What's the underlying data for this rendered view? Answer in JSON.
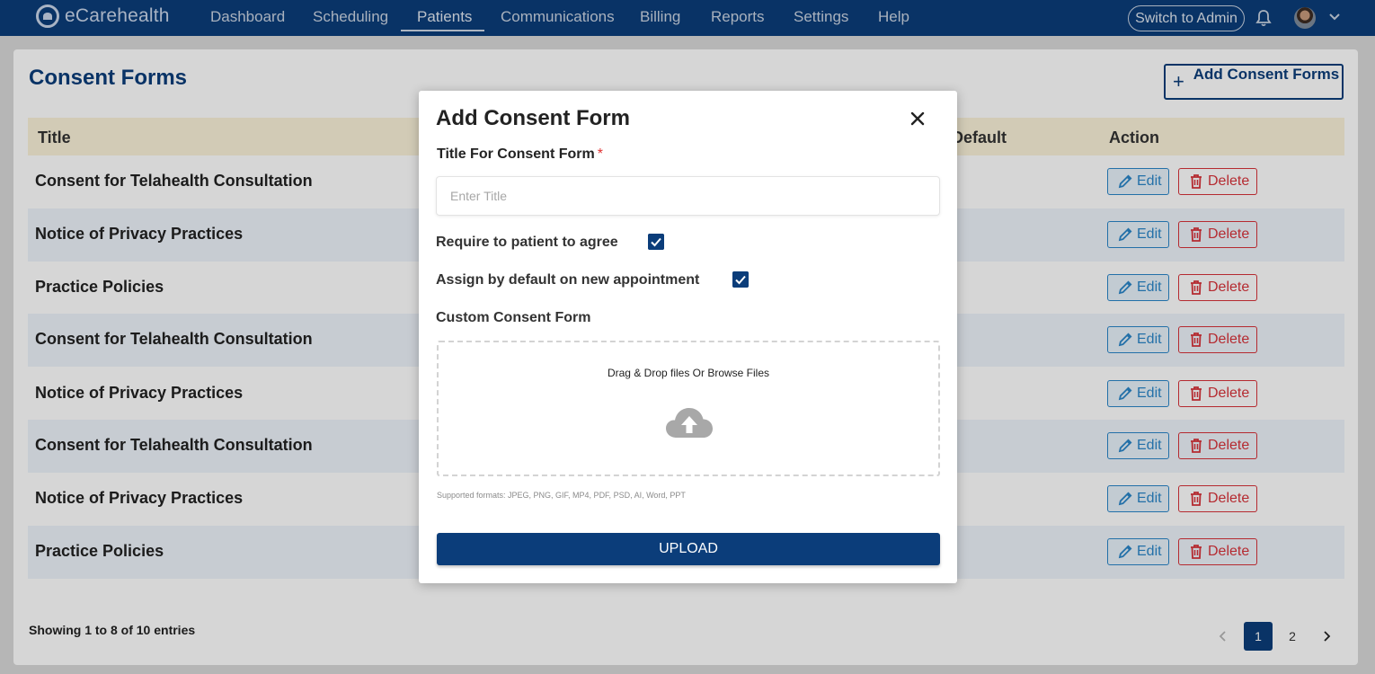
{
  "app": {
    "logo_text": "eCarehealth",
    "nav": [
      "Dashboard",
      "Scheduling",
      "Patients",
      "Communications",
      "Billing",
      "Reports",
      "Settings",
      "Help"
    ],
    "active_nav": "Patients",
    "switch_admin_label": "Switch to Admin",
    "icons": {
      "notifications": "bell-icon",
      "profile": "avatar",
      "profile_menu": "chevron-down-icon"
    }
  },
  "page": {
    "title": "Consent Forms",
    "add_button_label": "Add Consent Forms",
    "columns": {
      "title": "Title",
      "default": "Default",
      "action": "Action"
    },
    "rows": [
      {
        "title": "Consent for Telahealth Consultation"
      },
      {
        "title": "Notice of Privacy Practices"
      },
      {
        "title": "Practice Policies"
      },
      {
        "title": "Consent for Telahealth Consultation"
      },
      {
        "title": "Notice of Privacy Practices"
      },
      {
        "title": "Consent for Telahealth Consultation"
      },
      {
        "title": "Notice of Privacy Practices"
      },
      {
        "title": "Practice Policies"
      }
    ],
    "edit_label": "Edit",
    "delete_label": "Delete",
    "showing_text": "Showing 1 to 8 of 10 entries",
    "pagination": {
      "pages": [
        "1",
        "2"
      ],
      "current": "1"
    }
  },
  "modal": {
    "title": "Add Consent Form",
    "title_field_label": "Title For Consent Form",
    "required_mark": "*",
    "title_placeholder": "Enter Title",
    "title_value": "",
    "require_agree_label": "Require to patient to agree",
    "require_agree_checked": true,
    "assign_default_label": "Assign by default on new appointment",
    "assign_default_checked": true,
    "custom_form_label": "Custom Consent Form",
    "dropzone_text": "Drag & Drop files Or Browse Files",
    "formats_text": "Supported formats: JPEG, PNG, GIF, MP4, PDF, PSD, AI, Word, PPT",
    "upload_label": "UPLOAD"
  },
  "colors": {
    "brand": "#0b3d7a",
    "edit": "#2a86c9",
    "delete": "#d8333a",
    "table_header": "#fbf2d9",
    "row_alt": "#eef3fb"
  }
}
